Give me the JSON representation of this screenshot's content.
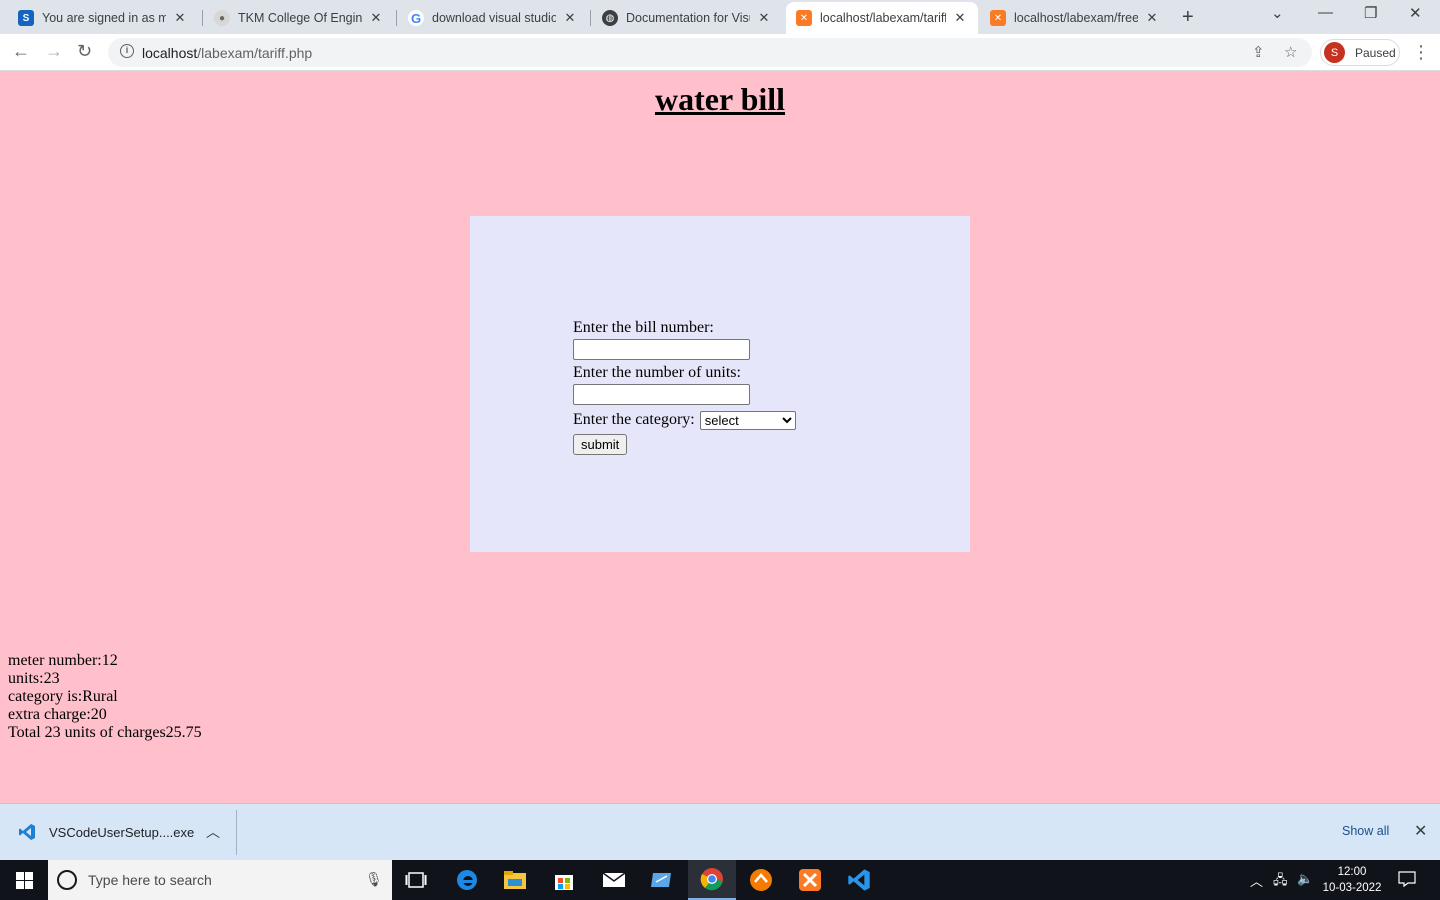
{
  "browser": {
    "tabs": [
      {
        "title": "You are signed in as mca",
        "favicon": "s-icon",
        "color": "#1565c0"
      },
      {
        "title": "TKM College Of Enginee",
        "favicon": "college-icon",
        "color": "#8a8a8a"
      },
      {
        "title": "download visual studio c",
        "favicon": "google-icon",
        "color": "#4285f4"
      },
      {
        "title": "Documentation for Visu",
        "favicon": "globe-icon",
        "color": "#3c4043"
      },
      {
        "title": "localhost/labexam/tariff",
        "favicon": "xampp-icon",
        "color": "#fb7a24"
      },
      {
        "title": "localhost/labexam/freed",
        "favicon": "xampp-icon",
        "color": "#fb7a24"
      }
    ],
    "address": {
      "host": "localhost",
      "path": "/labexam/tariff.php"
    },
    "profile": {
      "initial": "S",
      "status": "Paused"
    }
  },
  "page": {
    "heading": "water bill",
    "form": {
      "bill_label": "Enter the bill number:",
      "units_label": "Enter the number of units:",
      "category_label": "Enter the category:",
      "category_selected": "select",
      "submit_label": "submit"
    },
    "result": {
      "meter": "meter number:12",
      "units": "units:23",
      "category": "category is:Rural",
      "extra": "extra charge:20",
      "total": "Total 23 units of charges25.75"
    }
  },
  "download_bar": {
    "file_name": "VSCodeUserSetup....exe",
    "show_all": "Show all"
  },
  "taskbar": {
    "search_placeholder": "Type here to search",
    "time": "12:00",
    "date": "10-03-2022"
  },
  "colors": {
    "page_bg": "#ffc0cb",
    "form_bg": "#e6e6fa",
    "download_bar_bg": "#d6e6f7",
    "taskbar_bg": "#101319"
  }
}
